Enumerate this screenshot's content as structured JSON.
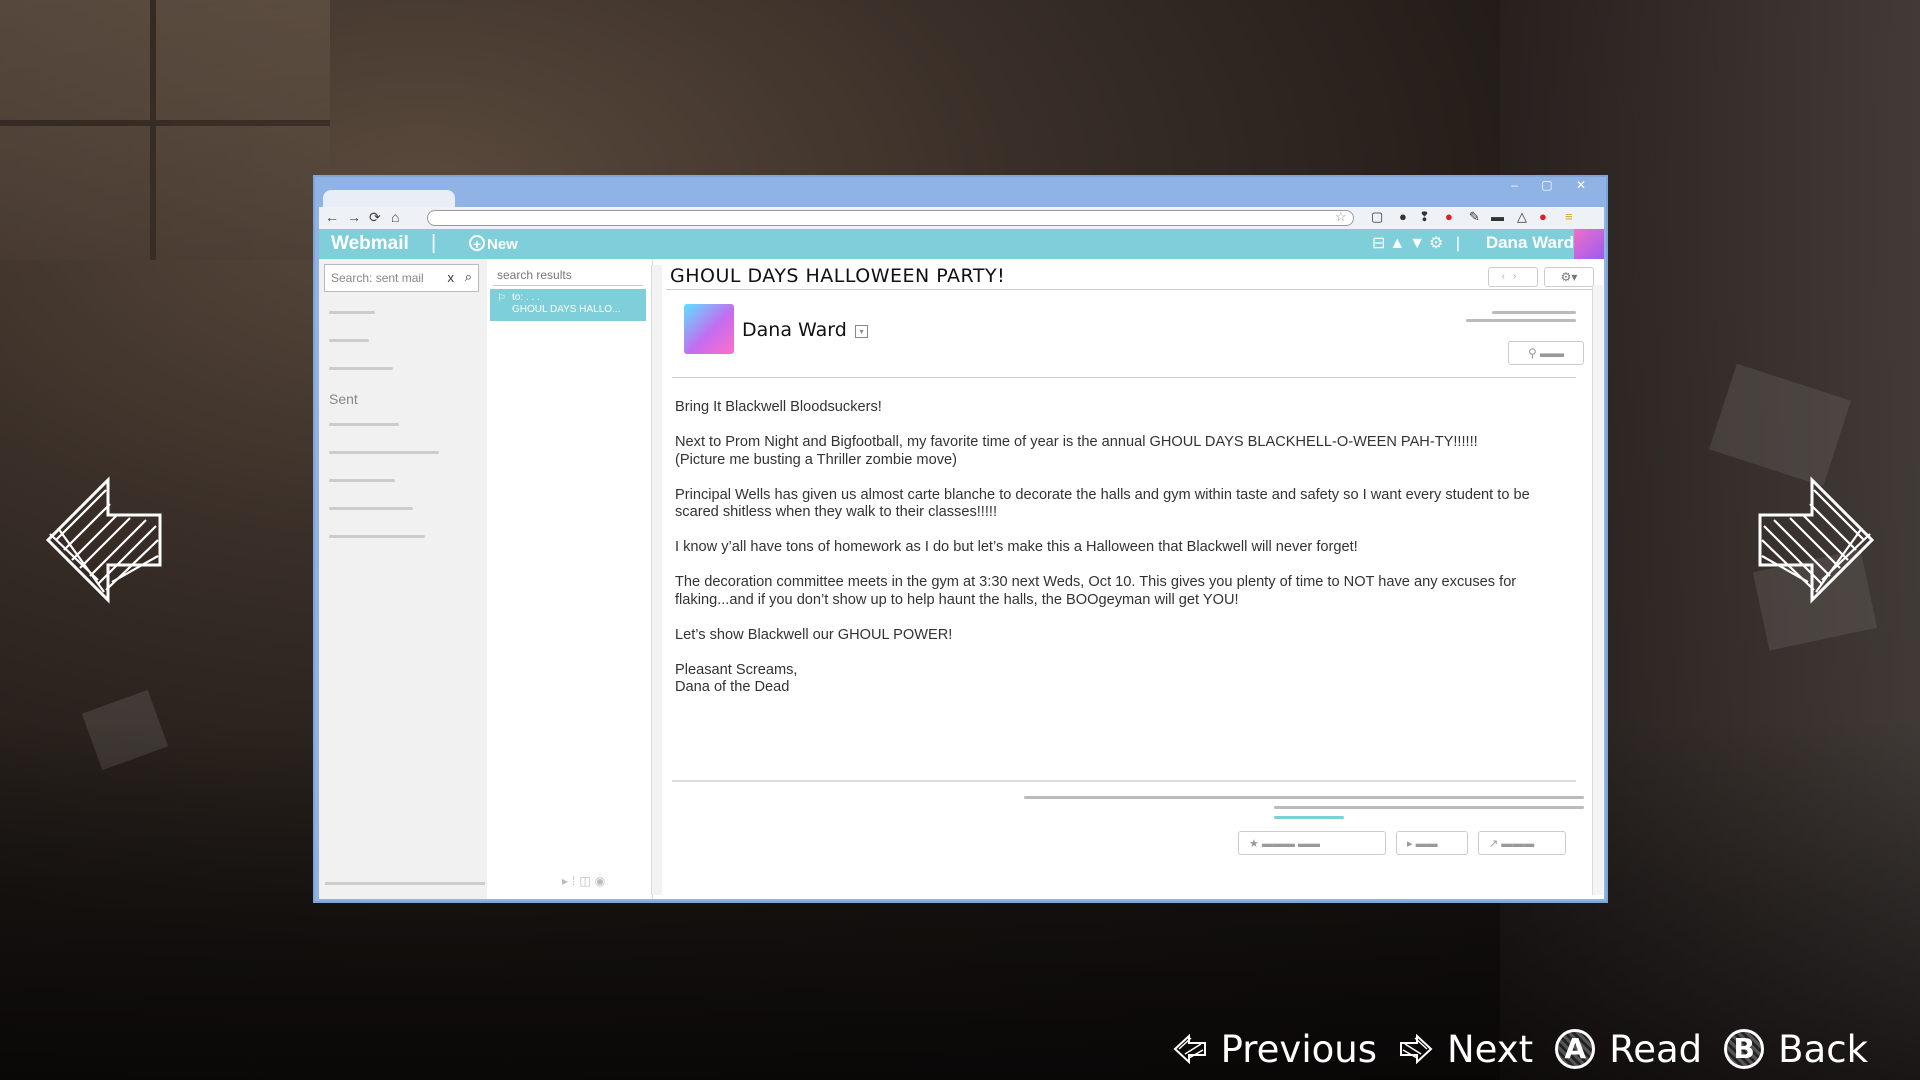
{
  "browser": {
    "tab_label": "",
    "window_controls": "– ▢ ✕"
  },
  "appbar": {
    "brand": "Webmail",
    "separator": "|",
    "new_label": "New",
    "user_name": "Dana Ward"
  },
  "left_pane": {
    "search_placeholder": "Search: sent mail",
    "sent_label": "Sent"
  },
  "results_pane": {
    "header": "search results",
    "item": {
      "to": "to: . . .",
      "subject": "GHOUL DAYS HALLO..."
    }
  },
  "message": {
    "subject": "GHOUL DAYS HALLOWEEN PARTY!",
    "sender": "Dana Ward",
    "body": [
      "Bring It Blackwell Bloodsuckers!",
      "Next to Prom Night and Bigfootball, my favorite time of year is the annual GHOUL DAYS BLACKHELL-O-WEEN PAH-TY!!!!!!\n(Picture me busting a Thriller zombie move)",
      "Principal Wells has given us almost carte blanche to decorate the halls and gym within taste and safety so I want every student to be scared shitless when they walk to their classes!!!!!",
      "I know y’all have tons of homework as I do but let’s make this a Halloween that Blackwell will never forget!",
      "The decoration committee meets in the gym at 3:30 next Weds, Oct 10. This gives you plenty of time to NOT have any excuses for flaking...and if you don’t show up to help haunt the halls, the BOOgeyman will get YOU!",
      "Let’s show Blackwell our GHOUL POWER!",
      "Pleasant Screams,\nDana of the Dead"
    ]
  },
  "hints": {
    "previous": "Previous",
    "next": "Next",
    "read": "Read",
    "back": "Back",
    "read_button": "A",
    "back_button": "B"
  },
  "colors": {
    "browser_frame": "#8eb3e4",
    "appbar": "#7ecfd9",
    "selected_item": "#7ecfd9"
  }
}
